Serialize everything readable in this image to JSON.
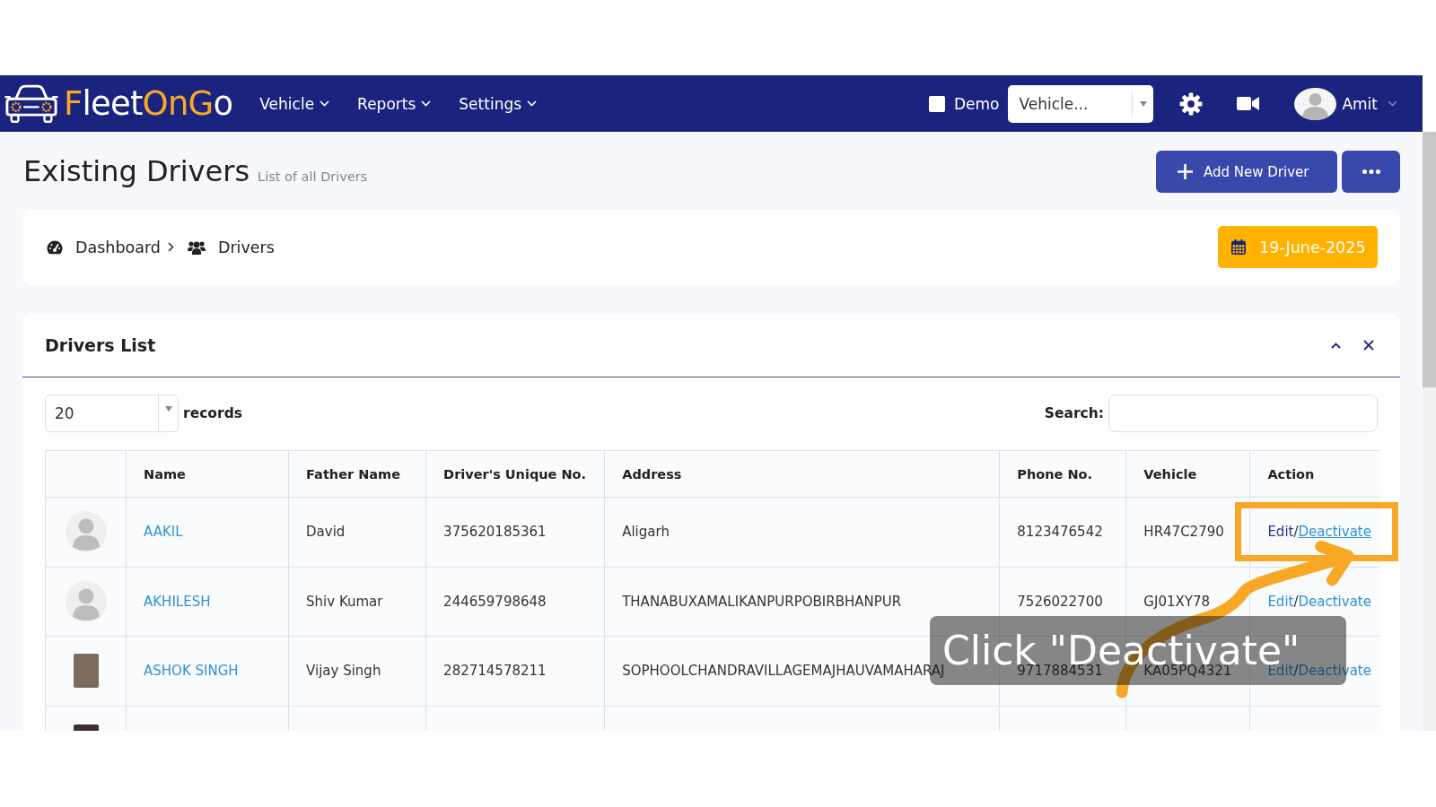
{
  "navbar": {
    "logo": [
      {
        "text": "F",
        "color": "#f9a825"
      },
      {
        "text": "leet",
        "color": "#ffffff"
      },
      {
        "text": "On",
        "color": "#f9a825"
      },
      {
        "text": "G",
        "color": "#f9a825"
      },
      {
        "text": "o",
        "color": "#ffffff"
      }
    ],
    "menu": [
      {
        "label": "Vehicle"
      },
      {
        "label": "Reports"
      },
      {
        "label": "Settings"
      }
    ],
    "demo": {
      "label": "Demo",
      "checked": false
    },
    "vehicle_select": {
      "placeholder": "Vehicle..."
    },
    "user": {
      "name": "Amit"
    }
  },
  "page_header": {
    "title": "Existing Drivers",
    "subtitle": "List of all Drivers",
    "add_button": "Add New Driver"
  },
  "breadcrumb": {
    "items": [
      {
        "label": "Dashboard"
      },
      {
        "label": "Drivers"
      }
    ],
    "date": "19-June-2025"
  },
  "drivers_list": {
    "title": "Drivers List",
    "page_size": "20",
    "records_label": "records",
    "search_label": "Search:",
    "columns": [
      "Name",
      "Father Name",
      "Driver's Unique No.",
      "Address",
      "Phone No.",
      "Vehicle",
      "Action"
    ],
    "rows": [
      {
        "avatar": {
          "kind": "silhouette"
        },
        "name": "AAKIL",
        "father_name": "David",
        "unique_no": "375620185361",
        "address": "Aligarh",
        "phone": "8123476542",
        "vehicle": "HR47C2790",
        "action": {
          "edit": "Edit",
          "separator": "/",
          "deactivate": "Deactivate",
          "hovered": true
        },
        "highlighted": true
      },
      {
        "avatar": {
          "kind": "silhouette"
        },
        "name": "AKHILESH",
        "father_name": "Shiv Kumar",
        "unique_no": "244659798648",
        "address": "THANABUXAMALIKANPURPOBIRBHANPUR",
        "phone": "7526022700",
        "vehicle": "GJ01XY78",
        "action": {
          "edit": "Edit",
          "separator": "/",
          "deactivate": "Deactivate",
          "hovered": false
        },
        "highlighted": false
      },
      {
        "avatar": {
          "kind": "photo"
        },
        "name": "ASHOK SINGH",
        "father_name": "Vijay Singh",
        "unique_no": "282714578211",
        "address": "SOPHOOLCHANDRAVILLAGEMAJHAUVAMAHARAJ",
        "phone": "9717884531",
        "vehicle": "KA05PQ4321",
        "action": {
          "edit": "Edit",
          "separator": "/",
          "deactivate": "Deactivate",
          "hovered": false
        },
        "highlighted": false
      },
      {
        "avatar": {
          "kind": "photo"
        }
      }
    ]
  },
  "callout": {
    "text": "Click \"Deactivate\""
  }
}
